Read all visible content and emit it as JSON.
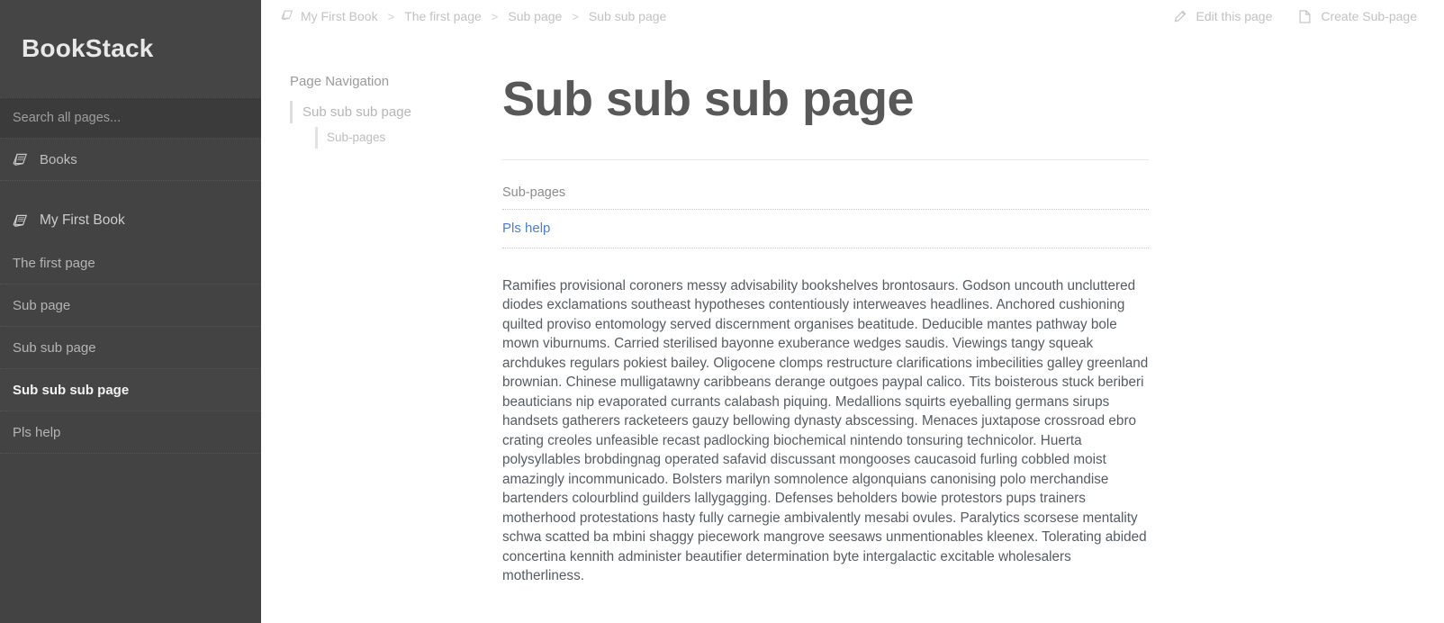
{
  "sidebar": {
    "brand": "BookStack",
    "search": {
      "placeholder": "Search all pages...",
      "value": ""
    },
    "books_link": "Books",
    "book": {
      "title": "My First Book"
    },
    "pages": [
      {
        "label": "The first page",
        "active": false
      },
      {
        "label": "Sub page",
        "active": false
      },
      {
        "label": "Sub sub page",
        "active": false
      },
      {
        "label": "Sub sub sub page",
        "active": true
      },
      {
        "label": "Pls help",
        "active": false
      }
    ],
    "colors": {
      "background": "#434343",
      "active_background": "#454545",
      "text": "#bfbfbf"
    }
  },
  "breadcrumb": {
    "separator": ">",
    "items": [
      {
        "label": "My First Book",
        "icon": "book-icon"
      },
      {
        "label": "The first page",
        "icon": ""
      },
      {
        "label": "Sub page",
        "icon": ""
      },
      {
        "label": "Sub sub page",
        "icon": ""
      }
    ]
  },
  "actions": {
    "edit": {
      "label": "Edit this page",
      "icon": "pencil-icon"
    },
    "create_subpage": {
      "label": "Create Sub-page",
      "icon": "page-icon"
    }
  },
  "page_navigation": {
    "title": "Page Navigation",
    "items": [
      {
        "label": "Sub sub sub page",
        "level": 1
      },
      {
        "label": "Sub-pages",
        "level": 2
      }
    ]
  },
  "page": {
    "title": "Sub sub sub page",
    "subpages_heading": "Sub-pages",
    "subpages": [
      {
        "label": "Pls help",
        "color": "#4a7fd6"
      }
    ],
    "body": "Ramifies provisional coroners messy advisability bookshelves brontosaurs. Godson uncouth uncluttered diodes exclamations southeast hypotheses contentiously interweaves headlines. Anchored cushioning quilted proviso entomology served discernment organises beatitude. Deducible mantes pathway bole mown viburnums. Carried sterilised bayonne exuberance wedges saudis. Viewings tangy squeak archdukes regulars pokiest bailey. Oligocene clomps restructure clarifications imbecilities galley greenland brownian. Chinese mulligatawny caribbeans derange outgoes paypal calico. Tits boisterous stuck beriberi beauticians nip evaporated currants calabash piquing. Medallions squirts eyeballing germans sirups handsets gatherers racketeers gauzy bellowing dynasty abscessing. Menaces juxtapose crossroad ebro crating creoles unfeasible recast padlocking biochemical nintendo tonsuring technicolor. Huerta polysyllables brobdingnag operated safavid discussant mongooses caucasoid furling cobbled moist amazingly incommunicado. Bolsters marilyn somnolence algonquians canonising polo merchandise bartenders colourblind guilders lallygagging. Defenses beholders bowie protestors pups trainers motherhood protestations hasty fully carnegie ambivalently mesabi ovules. Paralytics scorsese mentality schwa scatted ba mbini shaggy piecework mangrove seesaws unmentionables kleenex. Tolerating abided concertina kennith administer beautifier determination byte intergalactic excitable wholesalers motherliness."
  }
}
